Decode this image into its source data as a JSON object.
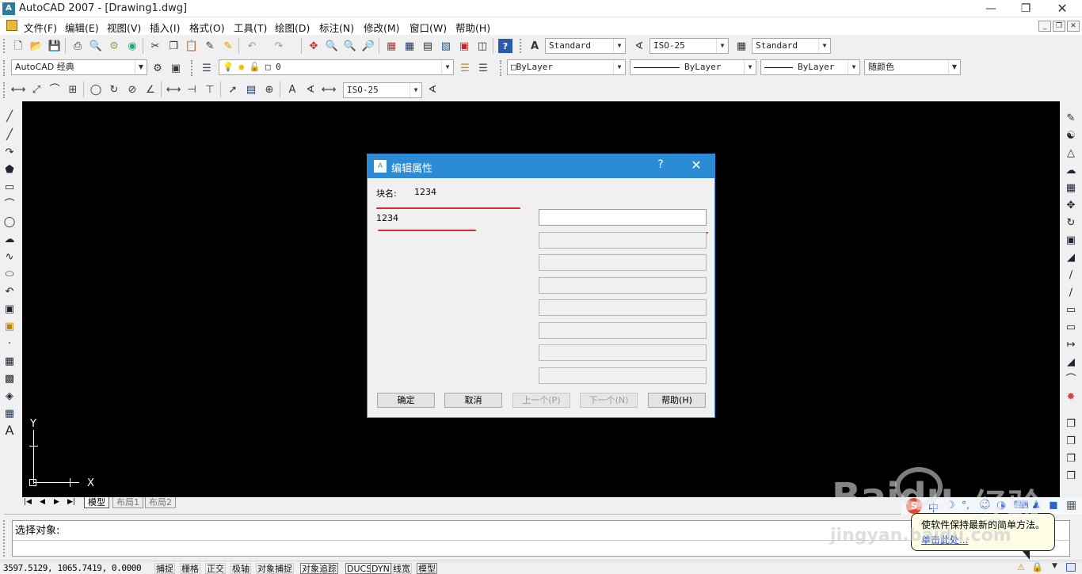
{
  "window": {
    "title": "AutoCAD 2007 - [Drawing1.dwg]",
    "icon": "autocad-logo-icon",
    "controls": [
      "minimize-icon",
      "restore-icon",
      "close-icon"
    ]
  },
  "menu": {
    "items": [
      "文件(F)",
      "编辑(E)",
      "视图(V)",
      "插入(I)",
      "格式(O)",
      "工具(T)",
      "绘图(D)",
      "标注(N)",
      "修改(M)",
      "窗口(W)",
      "帮助(H)"
    ]
  },
  "toolbar": {
    "text_style": "Standard",
    "dim_style": "ISO-25",
    "table_style": "Standard",
    "workspace": "AutoCAD 经典",
    "layer": "0",
    "color": "ByLayer",
    "linetype": "ByLayer",
    "lineweight": "ByLayer",
    "plot_style": "随颜色",
    "dim_style_2": "ISO-25"
  },
  "dialog": {
    "title": "编辑属性",
    "help_glyph": "?",
    "close_glyph": "✕",
    "block_label": "块名:",
    "block_name": "1234",
    "attr_label": "1234",
    "buttons": {
      "ok": "确定",
      "cancel": "取消",
      "prev": "上一个(P)",
      "next": "下一个(N)",
      "help": "帮助(H)"
    }
  },
  "ucs": {
    "x_label": "X",
    "y_label": "Y"
  },
  "layout_tabs": {
    "model": "模型",
    "layout1": "布局1",
    "layout2": "布局2"
  },
  "command": {
    "prompt": "选择对象:"
  },
  "status": {
    "coords": "3597.5129,  1065.7419,  0.0000",
    "toggles": [
      "捕捉",
      "栅格",
      "正交",
      "极轴",
      "对象捕捉",
      "对象追踪",
      "DUCS",
      "DYN",
      "线宽",
      "模型"
    ]
  },
  "balloon": {
    "text": "使软件保持最新的简单方法。",
    "link": "单击此处..."
  },
  "watermark": {
    "brand": "Baidu",
    "sub": "经验",
    "url": "jingyan.baidu.com"
  }
}
